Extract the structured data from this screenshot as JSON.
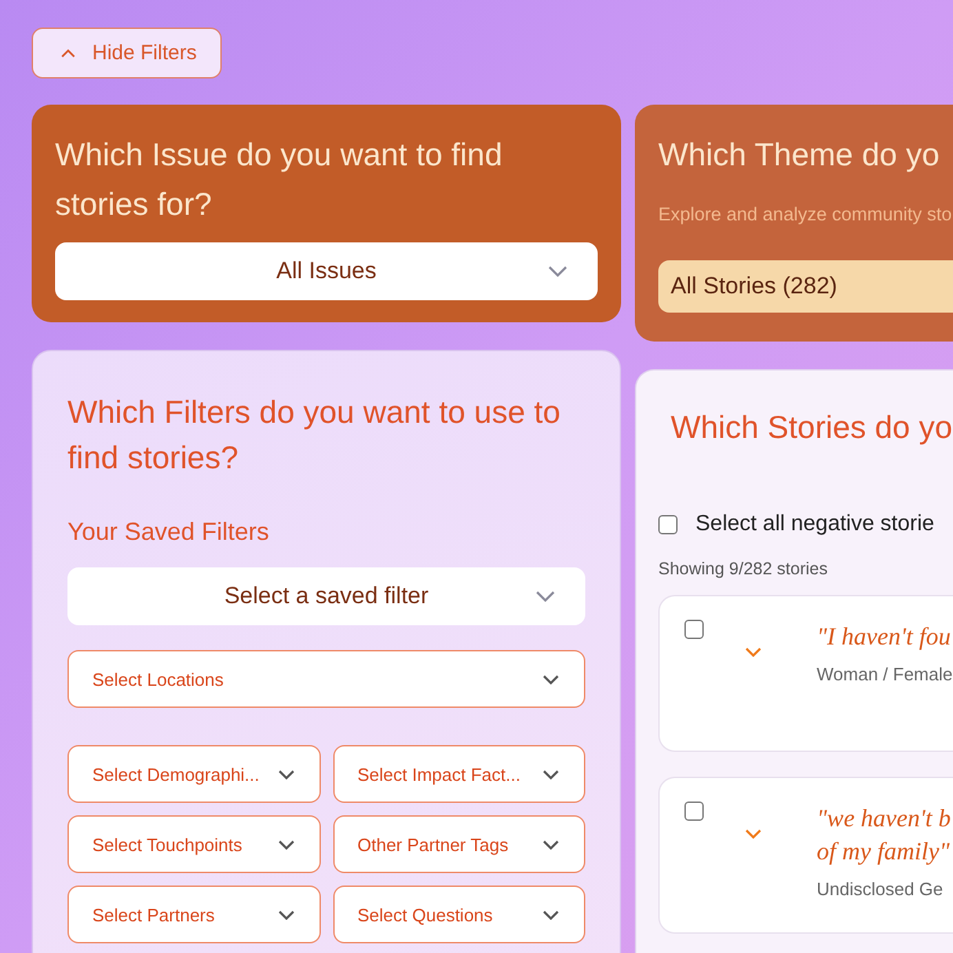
{
  "hide_filters_button": {
    "label": "Hide Filters"
  },
  "issue_panel": {
    "title": "Which Issue do you want to find stories for?",
    "dropdown": {
      "value": "All Issues"
    }
  },
  "theme_panel": {
    "title": "Which Theme do yo",
    "subtitle": "Explore and analyze community sto",
    "selected_theme": "All Stories (282)"
  },
  "filters_panel": {
    "title": "Which Filters do you want to use to find stories?",
    "saved_filters_label": "Your Saved Filters",
    "saved_filter_dropdown": {
      "placeholder": "Select a saved filter"
    },
    "filters": [
      {
        "label": "Select Locations",
        "wide": true
      },
      {
        "label": "Select Demographi...",
        "wide": false
      },
      {
        "label": "Select Impact Fact...",
        "wide": false
      },
      {
        "label": "Select Touchpoints",
        "wide": false
      },
      {
        "label": "Other Partner Tags",
        "wide": false
      },
      {
        "label": "Select Partners",
        "wide": false
      },
      {
        "label": "Select Questions",
        "wide": false
      }
    ]
  },
  "stories_panel": {
    "title": "Which Stories do yo",
    "select_all": {
      "label": "Select all negative storie",
      "checked": false
    },
    "count": "Showing 9/282 stories",
    "stories": [
      {
        "checked": false,
        "quote": [
          "\"I haven't fou"
        ],
        "meta": "Woman / Female"
      },
      {
        "checked": false,
        "quote": [
          "\"we haven't b",
          "of my family\""
        ],
        "meta": "Undisclosed Ge"
      }
    ]
  }
}
